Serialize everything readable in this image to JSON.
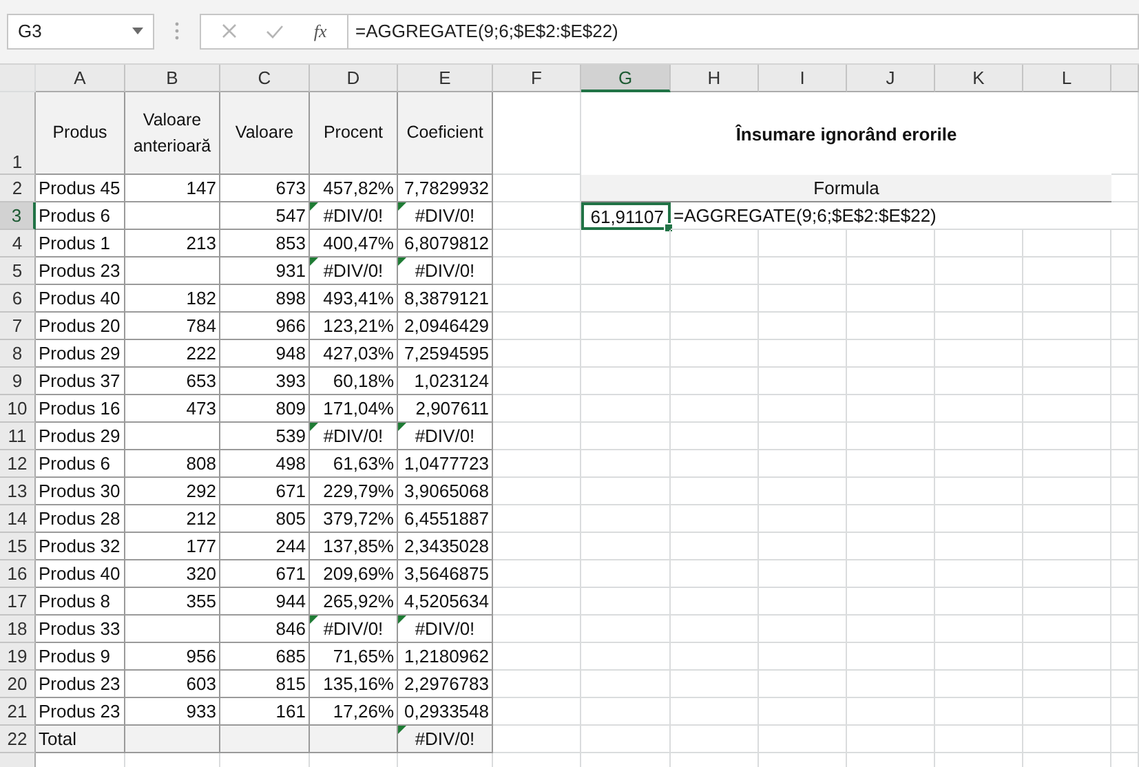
{
  "name_box": {
    "value": "G3"
  },
  "formula_bar": {
    "fx_label": "fx",
    "value": "=AGGREGATE(9;6;$E$2:$E$22)"
  },
  "columns": [
    {
      "label": "A",
      "selected": false
    },
    {
      "label": "B",
      "selected": false
    },
    {
      "label": "C",
      "selected": false
    },
    {
      "label": "D",
      "selected": false
    },
    {
      "label": "E",
      "selected": false
    },
    {
      "label": "F",
      "selected": false
    },
    {
      "label": "G",
      "selected": true
    },
    {
      "label": "H",
      "selected": false
    },
    {
      "label": "I",
      "selected": false
    },
    {
      "label": "J",
      "selected": false
    },
    {
      "label": "K",
      "selected": false
    },
    {
      "label": "L",
      "selected": false
    }
  ],
  "header_row": {
    "row": "1",
    "selected": false,
    "cells": [
      "Produs",
      "Valoare anterioară",
      "Valoare",
      "Procent",
      "Coeficient"
    ]
  },
  "rows": [
    {
      "row": "2",
      "selected": false,
      "kind": "data",
      "cells": [
        "Produs 45",
        "147",
        "673",
        "457,82%",
        "7,7829932"
      ]
    },
    {
      "row": "3",
      "selected": true,
      "kind": "data",
      "cells": [
        "Produs 6",
        null,
        "547",
        {
          "text": "#DIV/0!",
          "error_flag": true
        },
        {
          "text": "#DIV/0!",
          "error_flag": true
        }
      ]
    },
    {
      "row": "4",
      "selected": false,
      "kind": "data",
      "cells": [
        "Produs 1",
        "213",
        "853",
        "400,47%",
        "6,8079812"
      ]
    },
    {
      "row": "5",
      "selected": false,
      "kind": "data",
      "cells": [
        "Produs 23",
        null,
        "931",
        {
          "text": "#DIV/0!",
          "error_flag": true
        },
        {
          "text": "#DIV/0!",
          "error_flag": true
        }
      ]
    },
    {
      "row": "6",
      "selected": false,
      "kind": "data",
      "cells": [
        "Produs 40",
        "182",
        "898",
        "493,41%",
        "8,3879121"
      ]
    },
    {
      "row": "7",
      "selected": false,
      "kind": "data",
      "cells": [
        "Produs 20",
        "784",
        "966",
        "123,21%",
        "2,0946429"
      ]
    },
    {
      "row": "8",
      "selected": false,
      "kind": "data",
      "cells": [
        "Produs 29",
        "222",
        "948",
        "427,03%",
        "7,2594595"
      ]
    },
    {
      "row": "9",
      "selected": false,
      "kind": "data",
      "cells": [
        "Produs 37",
        "653",
        "393",
        "60,18%",
        "1,023124"
      ]
    },
    {
      "row": "10",
      "selected": false,
      "kind": "data",
      "cells": [
        "Produs 16",
        "473",
        "809",
        "171,04%",
        "2,907611"
      ]
    },
    {
      "row": "11",
      "selected": false,
      "kind": "data",
      "cells": [
        "Produs 29",
        null,
        "539",
        {
          "text": "#DIV/0!",
          "error_flag": true
        },
        {
          "text": "#DIV/0!",
          "error_flag": true
        }
      ]
    },
    {
      "row": "12",
      "selected": false,
      "kind": "data",
      "cells": [
        "Produs 6",
        "808",
        "498",
        "61,63%",
        "1,0477723"
      ]
    },
    {
      "row": "13",
      "selected": false,
      "kind": "data",
      "cells": [
        "Produs 30",
        "292",
        "671",
        "229,79%",
        "3,9065068"
      ]
    },
    {
      "row": "14",
      "selected": false,
      "kind": "data",
      "cells": [
        "Produs 28",
        "212",
        "805",
        "379,72%",
        "6,4551887"
      ]
    },
    {
      "row": "15",
      "selected": false,
      "kind": "data",
      "cells": [
        "Produs 32",
        "177",
        "244",
        "137,85%",
        "2,3435028"
      ]
    },
    {
      "row": "16",
      "selected": false,
      "kind": "data",
      "cells": [
        "Produs 40",
        "320",
        "671",
        "209,69%",
        "3,5646875"
      ]
    },
    {
      "row": "17",
      "selected": false,
      "kind": "data",
      "cells": [
        "Produs 8",
        "355",
        "944",
        "265,92%",
        "4,5205634"
      ]
    },
    {
      "row": "18",
      "selected": false,
      "kind": "data",
      "cells": [
        "Produs 33",
        null,
        "846",
        {
          "text": "#DIV/0!",
          "error_flag": true
        },
        {
          "text": "#DIV/0!",
          "error_flag": true
        }
      ]
    },
    {
      "row": "19",
      "selected": false,
      "kind": "data",
      "cells": [
        "Produs 9",
        "956",
        "685",
        "71,65%",
        "1,2180962"
      ]
    },
    {
      "row": "20",
      "selected": false,
      "kind": "data",
      "cells": [
        "Produs 23",
        "603",
        "815",
        "135,16%",
        "2,2976783"
      ]
    },
    {
      "row": "21",
      "selected": false,
      "kind": "data",
      "cells": [
        "Produs 23",
        "933",
        "161",
        "17,26%",
        "0,2933548"
      ]
    },
    {
      "row": "22",
      "selected": false,
      "kind": "total",
      "cells": [
        "Total",
        null,
        null,
        null,
        {
          "text": "#DIV/0!",
          "error_flag": true
        }
      ]
    }
  ],
  "summary": {
    "title": "Însumare ignorând erorile",
    "column_header": "Formula",
    "result": {
      "value": "61,91107",
      "selected": true
    },
    "formula_text": "=AGGREGATE(9;6;$E$2:$E$22)"
  }
}
